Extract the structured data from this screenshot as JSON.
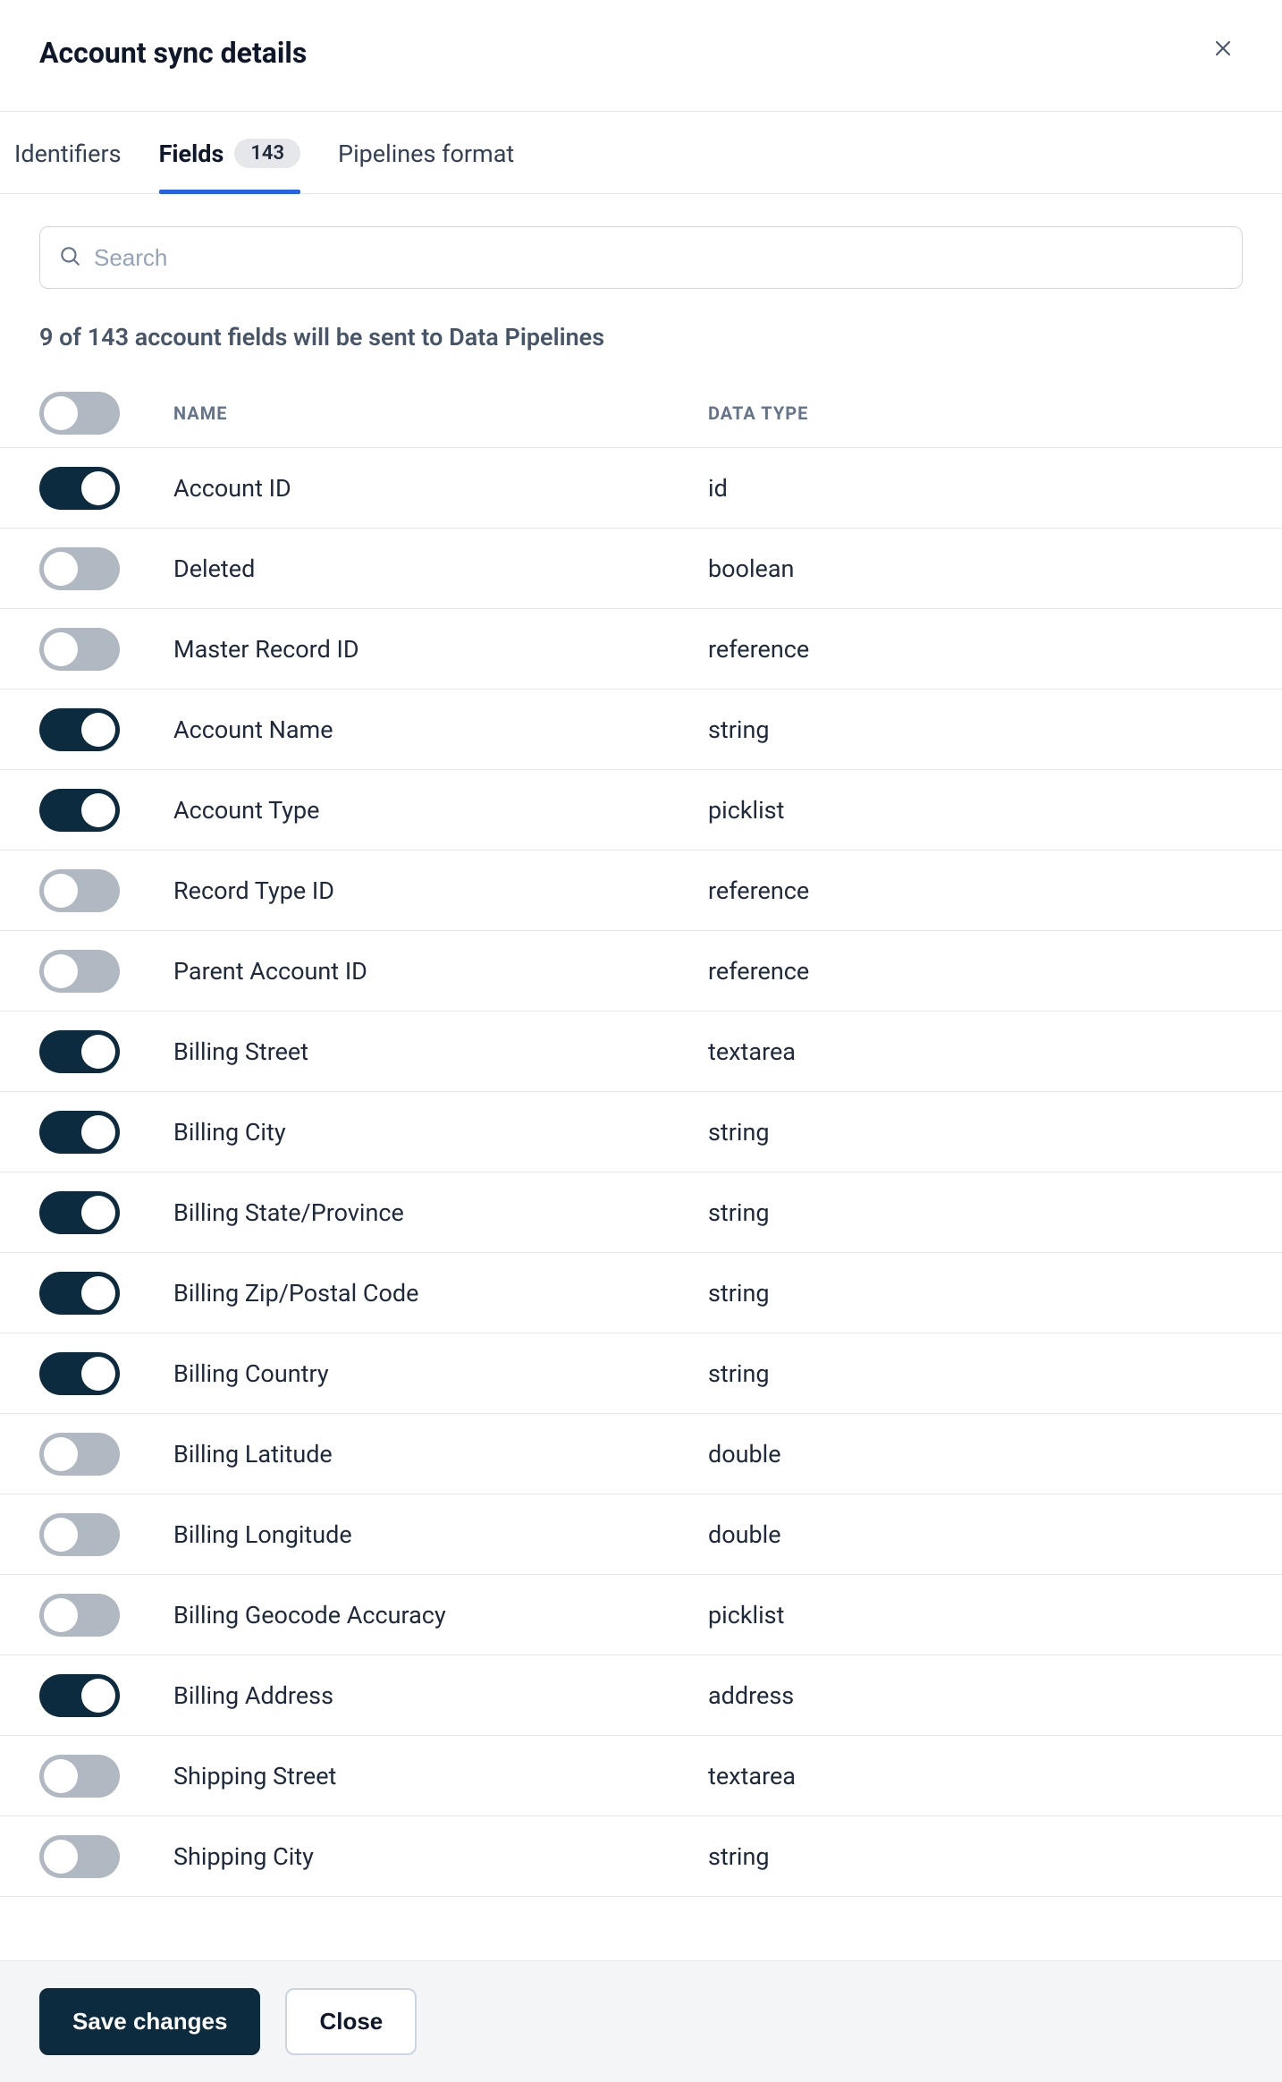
{
  "header": {
    "title": "Account sync details"
  },
  "tabs": {
    "identifiers": "Identifiers",
    "fields": "Fields",
    "fields_badge": "143",
    "pipelines": "Pipelines format"
  },
  "search": {
    "placeholder": "Search"
  },
  "summary": "9 of 143 account fields will be sent to Data Pipelines",
  "columns": {
    "name": "Name",
    "type": "Data Type"
  },
  "fields": [
    {
      "on": true,
      "name": "Account ID",
      "type": "id"
    },
    {
      "on": false,
      "name": "Deleted",
      "type": "boolean"
    },
    {
      "on": false,
      "name": "Master Record ID",
      "type": "reference"
    },
    {
      "on": true,
      "name": "Account Name",
      "type": "string"
    },
    {
      "on": true,
      "name": "Account Type",
      "type": "picklist"
    },
    {
      "on": false,
      "name": "Record Type ID",
      "type": "reference"
    },
    {
      "on": false,
      "name": "Parent Account ID",
      "type": "reference"
    },
    {
      "on": true,
      "name": "Billing Street",
      "type": "textarea"
    },
    {
      "on": true,
      "name": "Billing City",
      "type": "string"
    },
    {
      "on": true,
      "name": "Billing State/Province",
      "type": "string"
    },
    {
      "on": true,
      "name": "Billing Zip/Postal Code",
      "type": "string"
    },
    {
      "on": true,
      "name": "Billing Country",
      "type": "string"
    },
    {
      "on": false,
      "name": "Billing Latitude",
      "type": "double"
    },
    {
      "on": false,
      "name": "Billing Longitude",
      "type": "double"
    },
    {
      "on": false,
      "name": "Billing Geocode Accuracy",
      "type": "picklist"
    },
    {
      "on": true,
      "name": "Billing Address",
      "type": "address"
    },
    {
      "on": false,
      "name": "Shipping Street",
      "type": "textarea"
    },
    {
      "on": false,
      "name": "Shipping City",
      "type": "string"
    }
  ],
  "footer": {
    "save": "Save changes",
    "close": "Close"
  }
}
